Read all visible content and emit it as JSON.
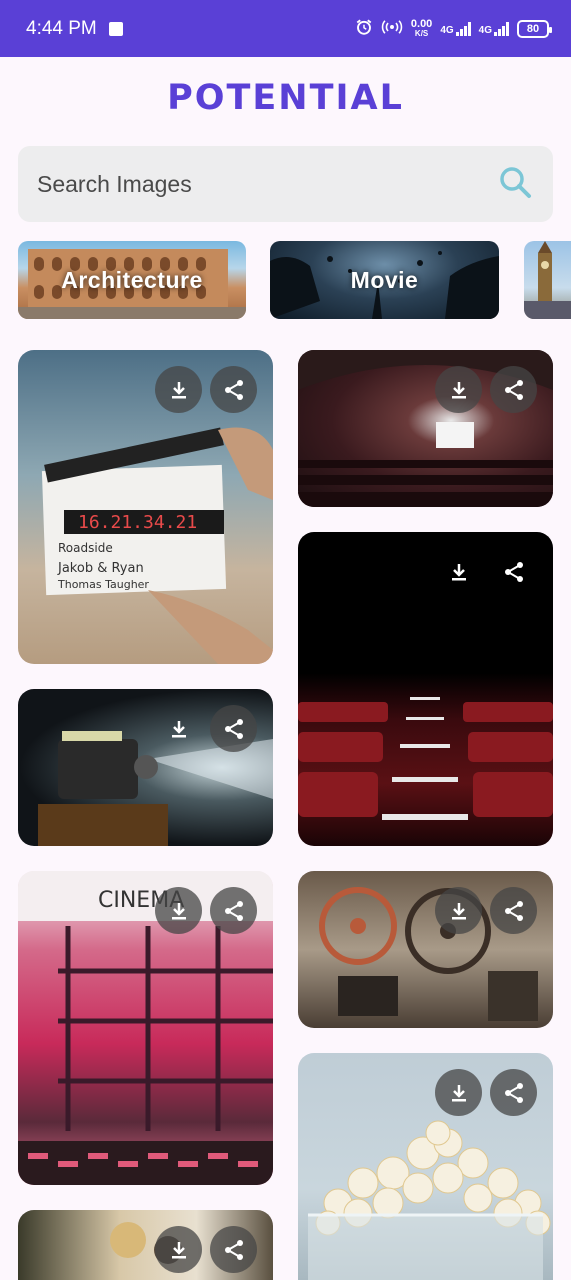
{
  "status_bar": {
    "time": "4:44 PM",
    "speed_value": "0.00",
    "speed_unit": "K/S",
    "net1": "4G",
    "net2": "4G",
    "battery": "80"
  },
  "app": {
    "title": "POTENTIAL"
  },
  "search": {
    "placeholder": "Search Images"
  },
  "categories": [
    {
      "label": "Architecture"
    },
    {
      "label": "Movie"
    }
  ],
  "colors": {
    "brand": "#5a40d6",
    "search_icon": "#7cc6d6"
  }
}
